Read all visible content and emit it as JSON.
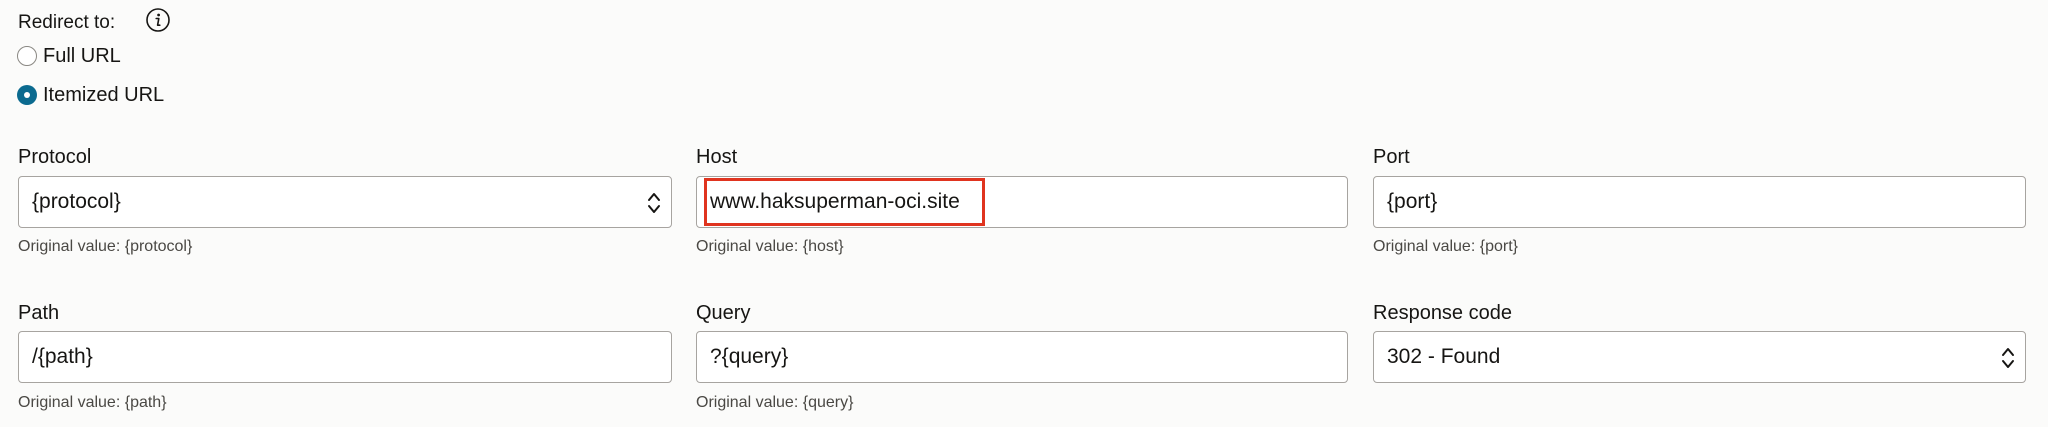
{
  "redirect": {
    "label": "Redirect to:",
    "info_icon": "info-icon",
    "options": [
      {
        "label": "Full URL",
        "checked": false
      },
      {
        "label": "Itemized URL",
        "checked": true
      }
    ]
  },
  "fields": {
    "protocol": {
      "label": "Protocol",
      "value": "{protocol}",
      "hint": "Original value: {protocol}"
    },
    "host": {
      "label": "Host",
      "value": "www.haksuperman-oci.site",
      "hint": "Original value: {host}"
    },
    "port": {
      "label": "Port",
      "value": "{port}",
      "hint": "Original value: {port}"
    },
    "path": {
      "label": "Path",
      "value": "/{path}",
      "hint": "Original value: {path}"
    },
    "query": {
      "label": "Query",
      "value": "?{query}",
      "hint": "Original value: {query}"
    },
    "response_code": {
      "label": "Response code",
      "value": "302 - Found"
    }
  },
  "colors": {
    "radio_selected": "#0b6a8f",
    "highlight_border": "#e0341f",
    "background": "#fbfbfa"
  }
}
